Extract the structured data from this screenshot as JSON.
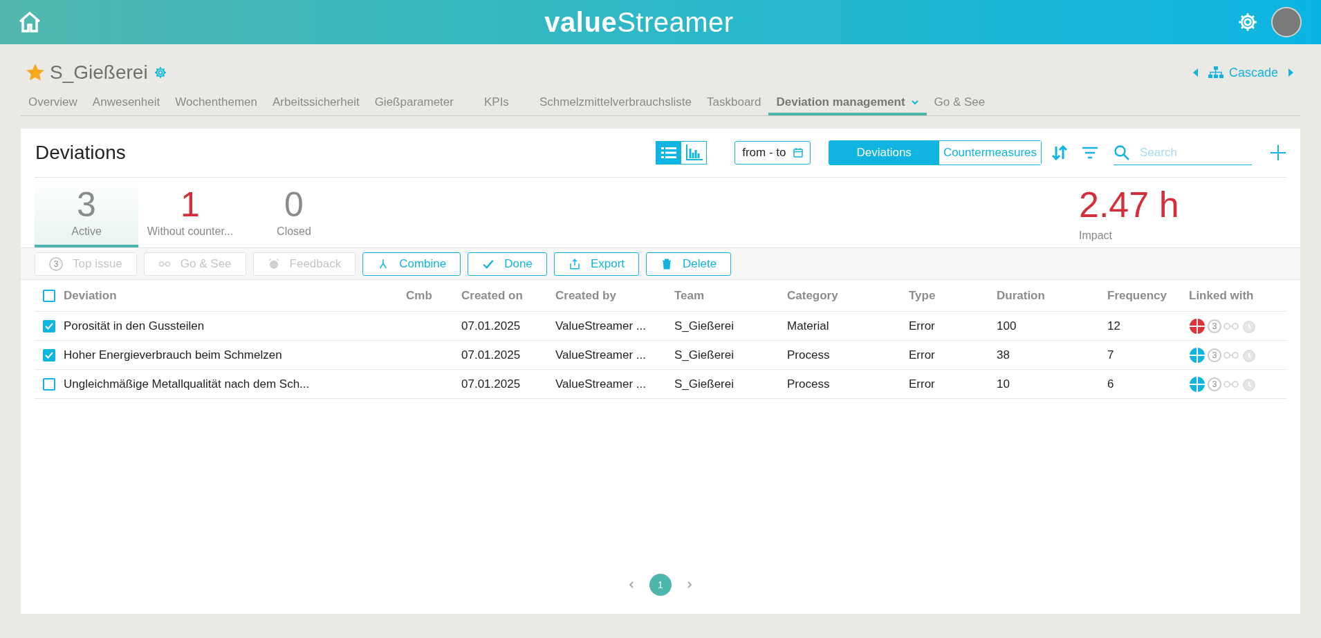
{
  "header": {
    "logo": "**value**Streamer"
  },
  "board": {
    "title": "S_Gießerei",
    "favorite": true,
    "cascade": "Cascade"
  },
  "tabs": [
    {
      "label": "Overview",
      "selected": false
    },
    {
      "label": "Anwesenheit",
      "selected": false
    },
    {
      "label": "Wochenthemen",
      "selected": false
    },
    {
      "label": "Arbeitssicherheit",
      "selected": false
    },
    {
      "label": "Gießparameter",
      "selected": false
    },
    {
      "label": "KPIs",
      "selected": false
    },
    {
      "label": "Schmelzmittelverbrauchsliste",
      "selected": false
    },
    {
      "label": "Taskboard",
      "selected": false
    },
    {
      "label": "Deviation management",
      "selected": true,
      "dropdown": true
    },
    {
      "label": "Go & See",
      "selected": false
    }
  ],
  "panel": {
    "title": "Deviations",
    "views": [
      {
        "kind": "list",
        "selected": true
      },
      {
        "kind": "chart",
        "selected": false
      }
    ],
    "date_range": "from - to",
    "modes": [
      {
        "label": "Deviations",
        "selected": true
      },
      {
        "label": "Countermeasures",
        "selected": false
      }
    ],
    "search": {
      "placeholder": "Search"
    }
  },
  "stats": [
    {
      "value": "3",
      "label": "Active",
      "selected": true,
      "color": "#8a8a8a"
    },
    {
      "value": "1",
      "label": "Without counter...",
      "selected": false,
      "color": "#d32f3a"
    },
    {
      "value": "0",
      "label": "Closed",
      "selected": false,
      "color": "#8a8a8a"
    }
  ],
  "impact": {
    "value": "2.47 h",
    "label": "Impact"
  },
  "actions": [
    {
      "kind": "topissue",
      "label": "Top issue",
      "disabled": true,
      "badge": "3"
    },
    {
      "kind": "gosee",
      "label": "Go & See",
      "disabled": true
    },
    {
      "kind": "feedback",
      "label": "Feedback",
      "disabled": true
    },
    {
      "kind": "combine",
      "label": "Combine",
      "disabled": false
    },
    {
      "kind": "done",
      "label": "Done",
      "disabled": false
    },
    {
      "kind": "export",
      "label": "Export",
      "disabled": false
    },
    {
      "kind": "delete",
      "label": "Delete",
      "disabled": false
    }
  ],
  "table": {
    "all_checked": false,
    "columns": [
      "Deviation",
      "Cmb",
      "Created on",
      "Created by",
      "Team",
      "Category",
      "Type",
      "Duration",
      "Frequency",
      "Linked with"
    ],
    "rows": [
      {
        "checked": true,
        "cells": [
          "Porosität in den Gussteilen",
          "",
          "07.01.2025",
          "ValueStreamer ...",
          "S_Gießerei",
          "Material",
          "Error",
          "100",
          "12"
        ],
        "linked": {
          "color": "#e0303a",
          "badge": "3"
        }
      },
      {
        "checked": true,
        "cells": [
          "Hoher Energieverbrauch beim Schmelzen",
          "",
          "07.01.2025",
          "ValueStreamer ...",
          "S_Gießerei",
          "Process",
          "Error",
          "38",
          "7"
        ],
        "linked": {
          "color": "#10b4e0",
          "badge": "3"
        }
      },
      {
        "checked": false,
        "cells": [
          "Ungleichmäßige Metallqualität nach dem Sch...",
          "",
          "07.01.2025",
          "ValueStreamer ...",
          "S_Gießerei",
          "Process",
          "Error",
          "10",
          "6"
        ],
        "linked": {
          "color": "#10b4e0",
          "badge": "3"
        }
      }
    ]
  },
  "pagination": {
    "pages": [
      {
        "label": "1",
        "selected": true
      }
    ]
  }
}
